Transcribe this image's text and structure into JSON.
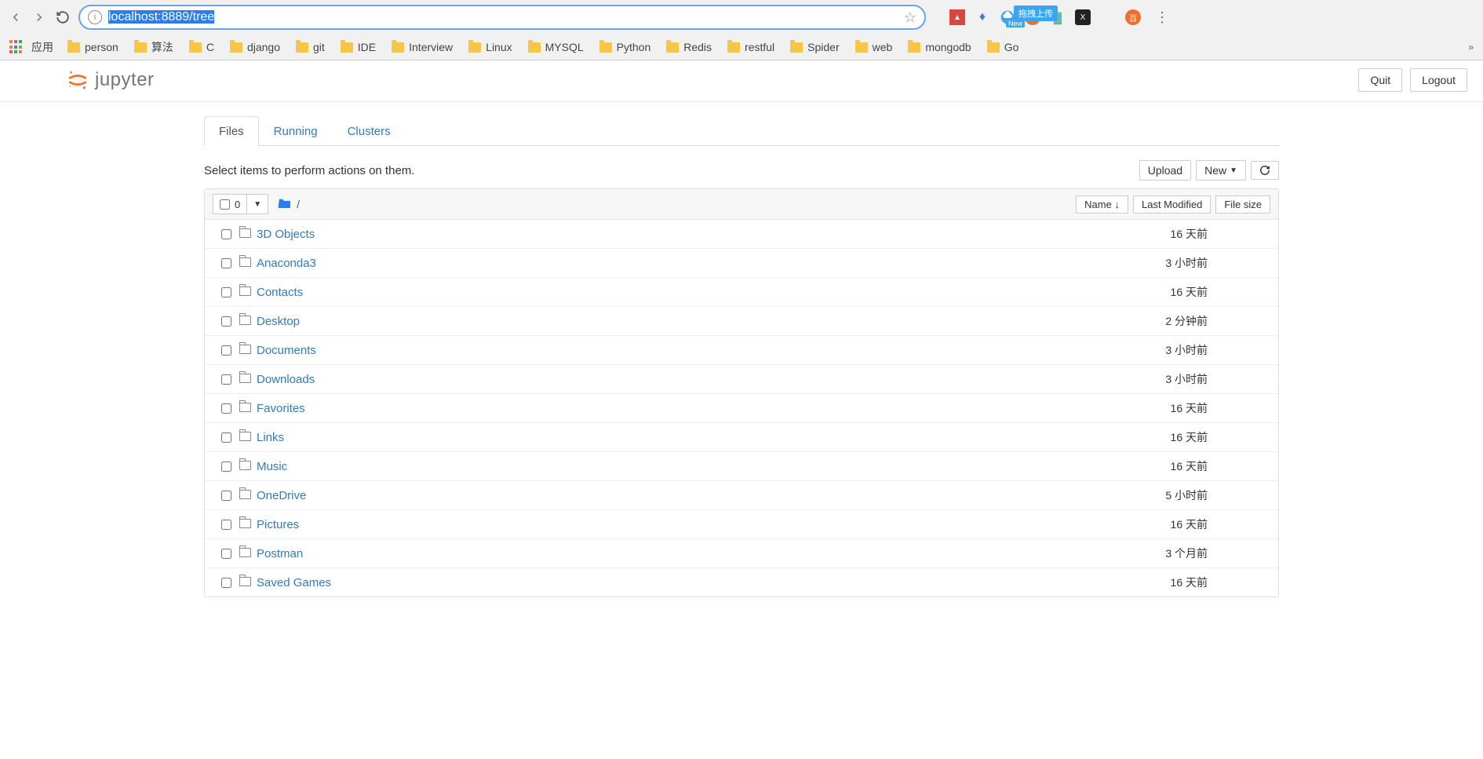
{
  "browser": {
    "url": "localhost:8889/tree",
    "apps_label": "应用",
    "bookmarks": [
      "person",
      "算法",
      "C",
      "django",
      "git",
      "IDE",
      "Interview",
      "Linux",
      "MYSQL",
      "Python",
      "Redis",
      "restful",
      "Spider",
      "web",
      "mongodb",
      "Go"
    ],
    "upload_tooltip": "拖拽上传",
    "new_badge": "New"
  },
  "header": {
    "logo_text": "jupyter",
    "quit": "Quit",
    "logout": "Logout"
  },
  "tabs": {
    "files": "Files",
    "running": "Running",
    "clusters": "Clusters"
  },
  "toolbar": {
    "hint": "Select items to perform actions on them.",
    "upload": "Upload",
    "new": "New",
    "selected_count": "0",
    "breadcrumb_sep": "/",
    "col_name": "Name",
    "col_modified": "Last Modified",
    "col_size": "File size"
  },
  "files": [
    {
      "name": "3D Objects",
      "modified": "16 天前",
      "size": ""
    },
    {
      "name": "Anaconda3",
      "modified": "3 小时前",
      "size": ""
    },
    {
      "name": "Contacts",
      "modified": "16 天前",
      "size": ""
    },
    {
      "name": "Desktop",
      "modified": "2 分钟前",
      "size": ""
    },
    {
      "name": "Documents",
      "modified": "3 小时前",
      "size": ""
    },
    {
      "name": "Downloads",
      "modified": "3 小时前",
      "size": ""
    },
    {
      "name": "Favorites",
      "modified": "16 天前",
      "size": ""
    },
    {
      "name": "Links",
      "modified": "16 天前",
      "size": ""
    },
    {
      "name": "Music",
      "modified": "16 天前",
      "size": ""
    },
    {
      "name": "OneDrive",
      "modified": "5 小时前",
      "size": ""
    },
    {
      "name": "Pictures",
      "modified": "16 天前",
      "size": ""
    },
    {
      "name": "Postman",
      "modified": "3 个月前",
      "size": ""
    },
    {
      "name": "Saved Games",
      "modified": "16 天前",
      "size": ""
    }
  ]
}
